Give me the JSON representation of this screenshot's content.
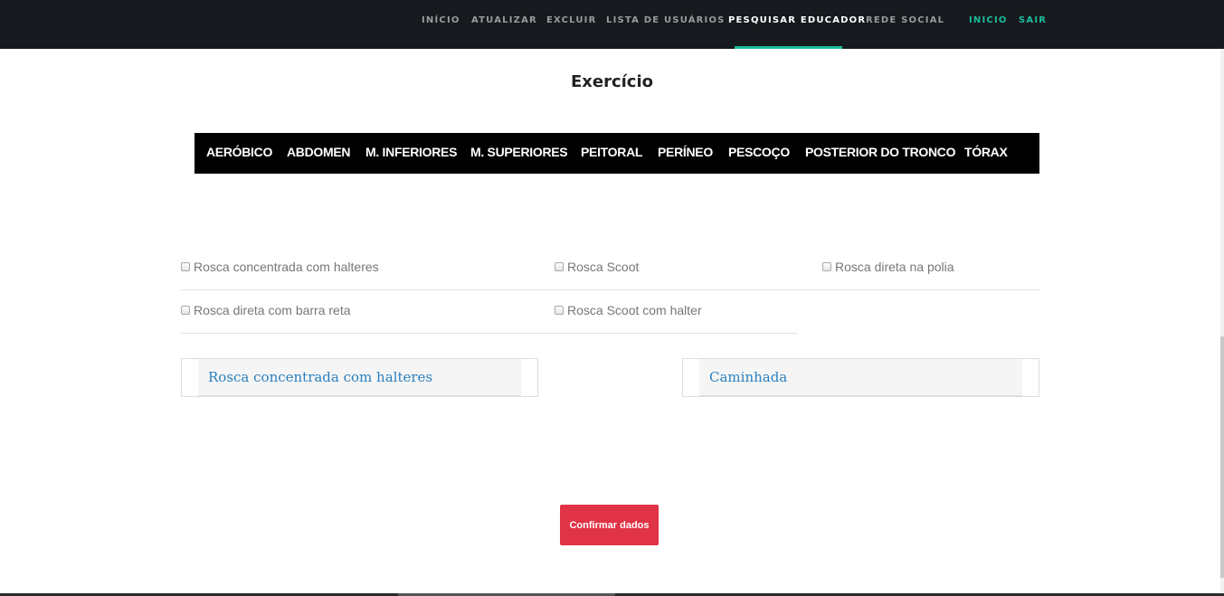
{
  "nav": {
    "items": [
      "INÍCIO",
      "ATUALIZAR",
      "EXCLUIR",
      "LISTA DE USUÁRIOS",
      "PESQUISAR EDUCADOR",
      "REDE SOCIAL"
    ],
    "active": "PESQUISAR EDUCADOR",
    "right_items": [
      "INICIO",
      "SAIR"
    ]
  },
  "page": {
    "title": "Exercício"
  },
  "categories": [
    "AERÓBICO",
    "ABDOMEN",
    "M. INFERIORES",
    "M. SUPERIORES",
    "PEITORAL",
    "PERÍNEO",
    "PESCOÇO",
    "POSTERIOR DO TRONCO",
    "TÓRAX"
  ],
  "options": [
    {
      "label": "Rosca concentrada com halteres",
      "checked": false
    },
    {
      "label": "Rosca Scoot",
      "checked": false
    },
    {
      "label": "Rosca direta na polia",
      "checked": false
    },
    {
      "label": "Rosca direta com barra reta",
      "checked": false
    },
    {
      "label": "Rosca Scoot com halter",
      "checked": false
    }
  ],
  "panels": [
    {
      "title": "Rosca concentrada com halteres"
    },
    {
      "title": "Caminhada"
    }
  ],
  "confirm_label": "Confirmar dados",
  "colors": {
    "navbar": "#16191d",
    "accent": "#1abc9c",
    "button": "#e03345",
    "panel_title": "#2a7fbf"
  }
}
